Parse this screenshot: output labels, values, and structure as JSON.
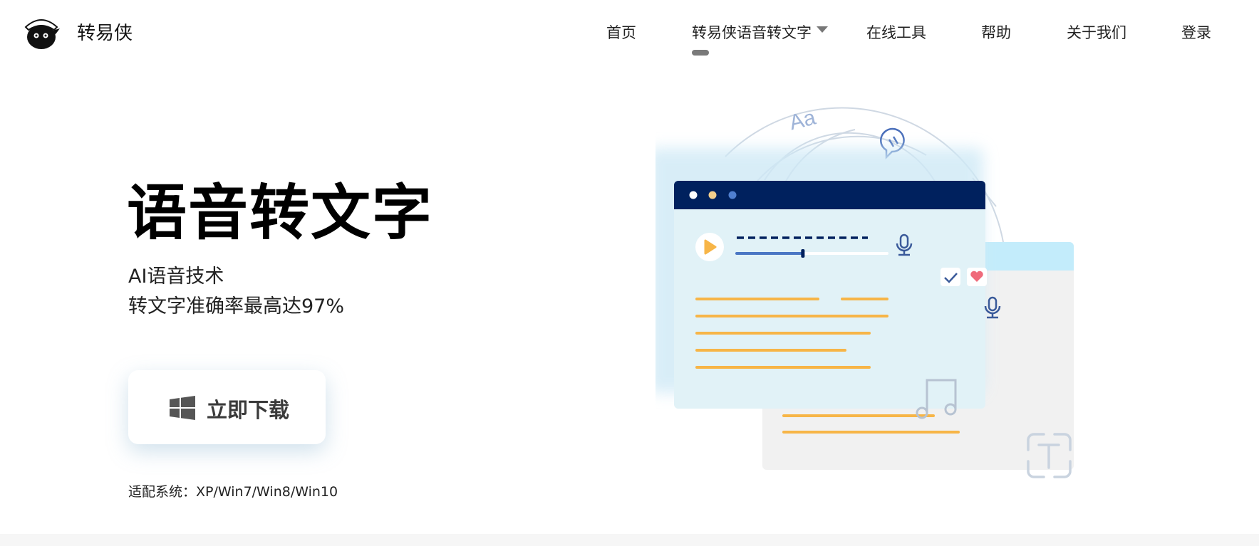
{
  "header": {
    "brand": "转易侠",
    "nav": [
      {
        "label": "首页"
      },
      {
        "label": "转易侠语音转文字"
      },
      {
        "label": "在线工具"
      },
      {
        "label": "帮助"
      },
      {
        "label": "关于我们"
      },
      {
        "label": "登录"
      }
    ]
  },
  "hero": {
    "title": "语音转文字",
    "subtitle_line1": "AI语音技术",
    "subtitle_line2": "转文字准确率最高达97%",
    "download_label": "立即下载",
    "compat": "适配系统：XP/Win7/Win8/Win10"
  },
  "illustration": {
    "aa_text": "Aa",
    "colors": {
      "titlebar": "#00215e",
      "panel": "#e1f2f7",
      "back_panel": "#f1f1f1",
      "back_header": "#c3ecfb",
      "lines": "#f7b547",
      "progress": "#4a77c4",
      "heart": "#ef6b7b"
    },
    "progress": 0.44,
    "icons": [
      "windows-icon",
      "play-icon",
      "microphone-icon",
      "check-icon",
      "heart-icon",
      "music-note-icon",
      "text-recognition-icon",
      "speech-bubble-icon"
    ]
  }
}
